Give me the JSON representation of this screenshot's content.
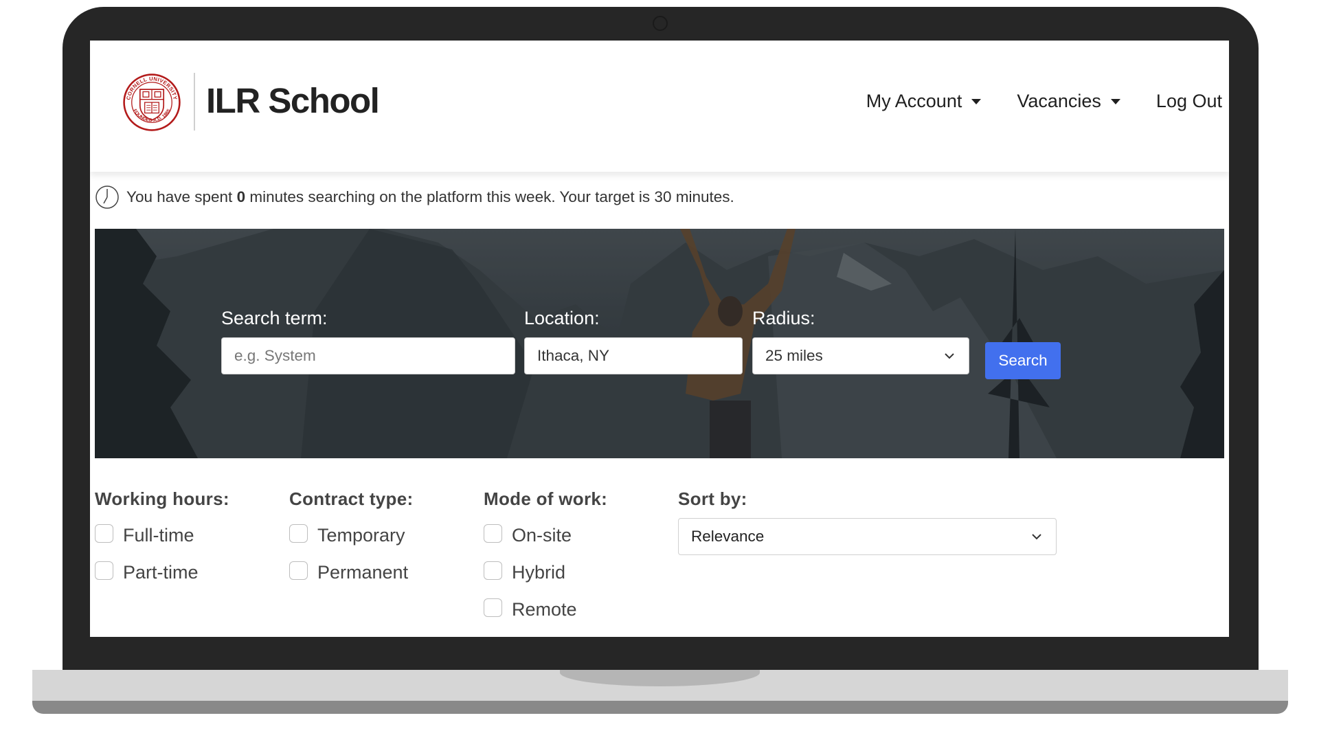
{
  "brand": {
    "name": "ILR School",
    "seal_text_top": "CORNELL UNIVERSITY",
    "seal_text_bottom": "FOUNDED A.D. 1865",
    "seal_color": "#b31b1b"
  },
  "nav": {
    "items": [
      {
        "label": "My Account",
        "has_dropdown": true
      },
      {
        "label": "Vacancies",
        "has_dropdown": true
      },
      {
        "label": "Log Out",
        "has_dropdown": false
      }
    ]
  },
  "time_tracker": {
    "prefix": "You have spent",
    "minutes_spent": "0",
    "suffix": "minutes searching on the platform this week. Your target is 30 minutes."
  },
  "search": {
    "term_label": "Search term:",
    "term_placeholder": "e.g. System",
    "term_value": "",
    "location_label": "Location:",
    "location_value": "Ithaca, NY",
    "radius_label": "Radius:",
    "radius_value": "25 miles",
    "button_label": "Search",
    "button_color": "#4270ee"
  },
  "filters": {
    "working_hours": {
      "title": "Working hours:",
      "options": [
        "Full-time",
        "Part-time"
      ]
    },
    "contract_type": {
      "title": "Contract type:",
      "options": [
        "Temporary",
        "Permanent"
      ]
    },
    "mode_of_work": {
      "title": "Mode of work:",
      "options": [
        "On-site",
        "Hybrid",
        "Remote"
      ]
    },
    "sort_by": {
      "title": "Sort by:",
      "value": "Relevance"
    }
  }
}
